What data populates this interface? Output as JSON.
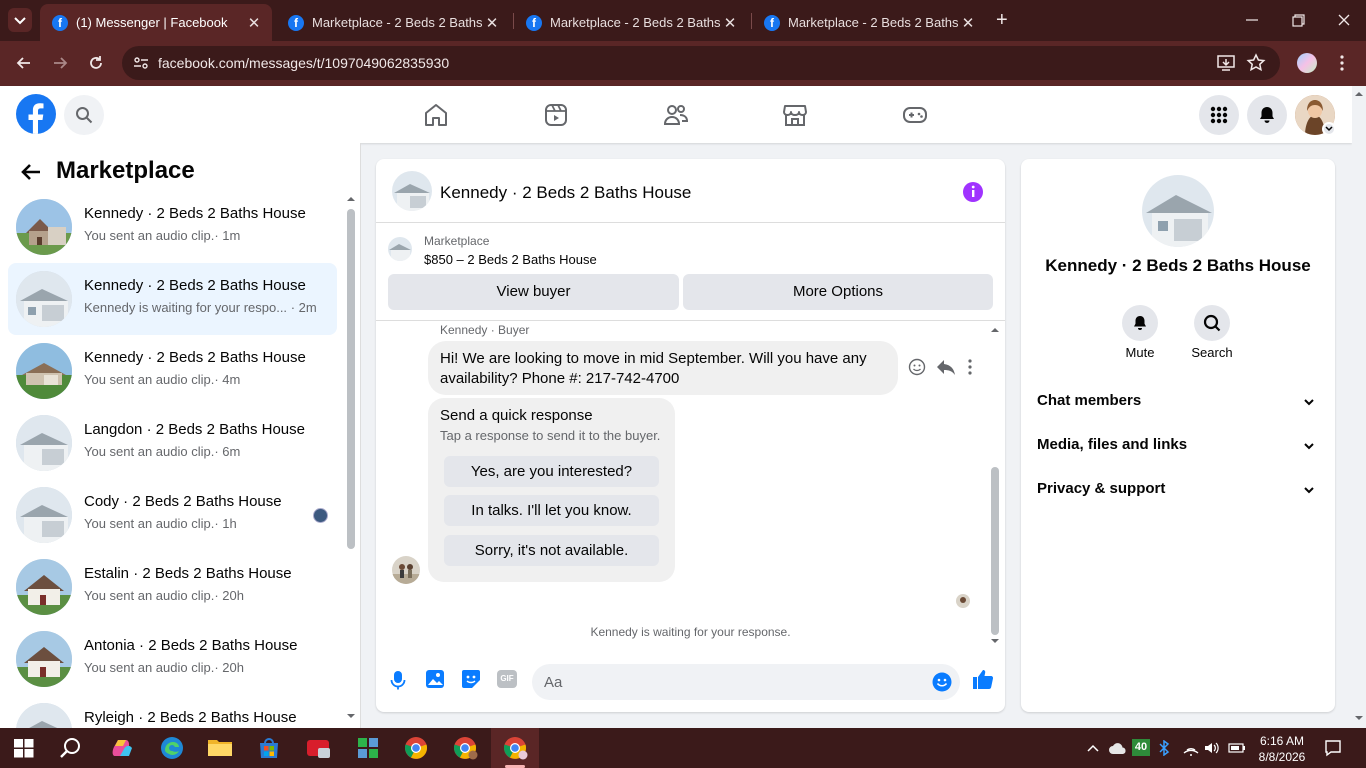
{
  "browser": {
    "tabs": [
      {
        "title": "(1) Messenger | Facebook",
        "active": true
      },
      {
        "title": "Marketplace - 2 Beds 2 Baths House",
        "active": false
      },
      {
        "title": "Marketplace - 2 Beds 2 Baths House",
        "active": false
      },
      {
        "title": "Marketplace - 2 Beds 2 Baths House",
        "active": false
      }
    ],
    "url": "facebook.com/messages/t/1097049062835930"
  },
  "left_panel": {
    "title": "Marketplace",
    "conversations": [
      {
        "name": "Kennedy · 2 Beds 2 Baths House",
        "preview": "You sent an audio clip.",
        "time": "· 1m"
      },
      {
        "name": "Kennedy · 2 Beds 2 Baths House",
        "preview": "Kennedy is waiting for your respo...",
        "time": "· 2m",
        "selected": true
      },
      {
        "name": "Kennedy · 2 Beds 2 Baths House",
        "preview": "You sent an audio clip.",
        "time": "· 4m"
      },
      {
        "name": "Langdon · 2 Beds 2 Baths House",
        "preview": "You sent an audio clip.",
        "time": "· 6m"
      },
      {
        "name": "Cody · 2 Beds 2 Baths House",
        "preview": "You sent an audio clip.",
        "time": "· 1h"
      },
      {
        "name": "Estalin · 2 Beds 2 Baths House",
        "preview": "You sent an audio clip.",
        "time": "· 20h"
      },
      {
        "name": "Antonia · 2 Beds 2 Baths House",
        "preview": "You sent an audio clip.",
        "time": "· 20h"
      },
      {
        "name": "Ryleigh · 2 Beds 2 Baths House",
        "preview": "",
        "time": ""
      }
    ]
  },
  "chat": {
    "title": "Kennedy · 2 Beds 2 Baths House",
    "listing_label": "Marketplace",
    "listing_price": "$850 – 2 Beds 2 Baths House",
    "view_buyer": "View buyer",
    "more_options": "More Options",
    "sender_label": "Kennedy · Buyer",
    "message": "Hi! We are looking to move in mid September. Will you have any availability? Phone #: 217-742-4700",
    "quick_title": "Send a quick response",
    "quick_sub": "Tap a response to send it to the buyer.",
    "quick_replies": [
      "Yes, are you interested?",
      "In talks. I'll let you know.",
      "Sorry, it's not available."
    ],
    "waiting": "Kennedy is waiting for your response.",
    "composer_placeholder": "Aa",
    "gif_label": "GIF"
  },
  "info_panel": {
    "title": "Kennedy · 2 Beds 2 Baths House",
    "mute": "Mute",
    "search": "Search",
    "sections": [
      "Chat members",
      "Media, files and links",
      "Privacy & support"
    ]
  },
  "taskbar": {
    "time": "6:16 AM",
    "date": "8/8/2026",
    "badge": "40"
  },
  "colors": {
    "fb_blue": "#1877f2",
    "chat_accent": "#0a7cff",
    "info_purple": "#a033ff",
    "browser_frame": "#3b1a1a",
    "browser_toolbar": "#5a2626"
  }
}
